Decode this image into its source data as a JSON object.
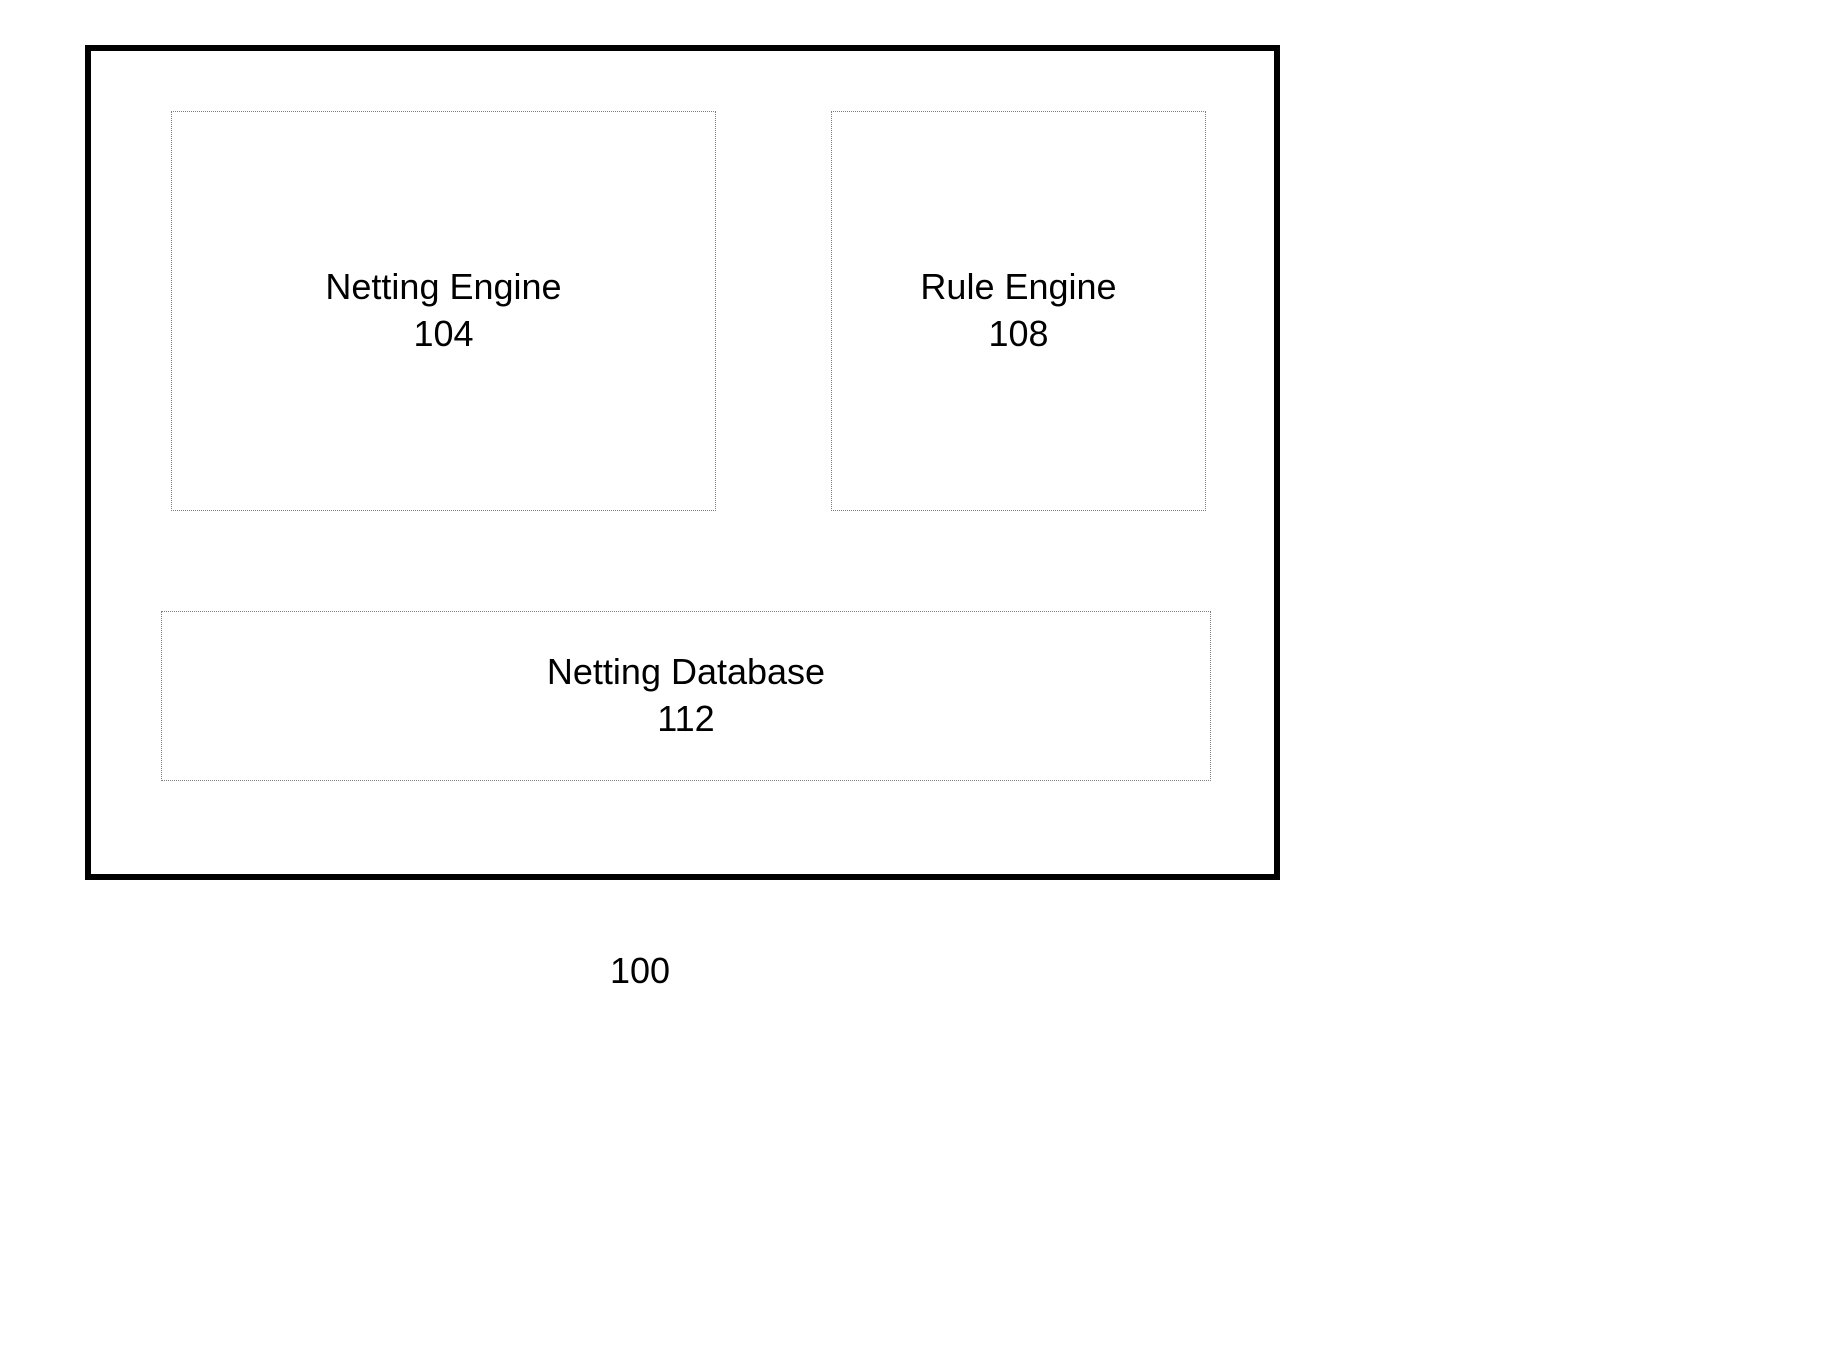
{
  "diagram": {
    "outer_label": "100",
    "boxes": {
      "netting_engine": {
        "title": "Netting Engine",
        "number": "104"
      },
      "rule_engine": {
        "title": "Rule Engine",
        "number": "108"
      },
      "netting_database": {
        "title": "Netting Database",
        "number": "112"
      }
    }
  }
}
